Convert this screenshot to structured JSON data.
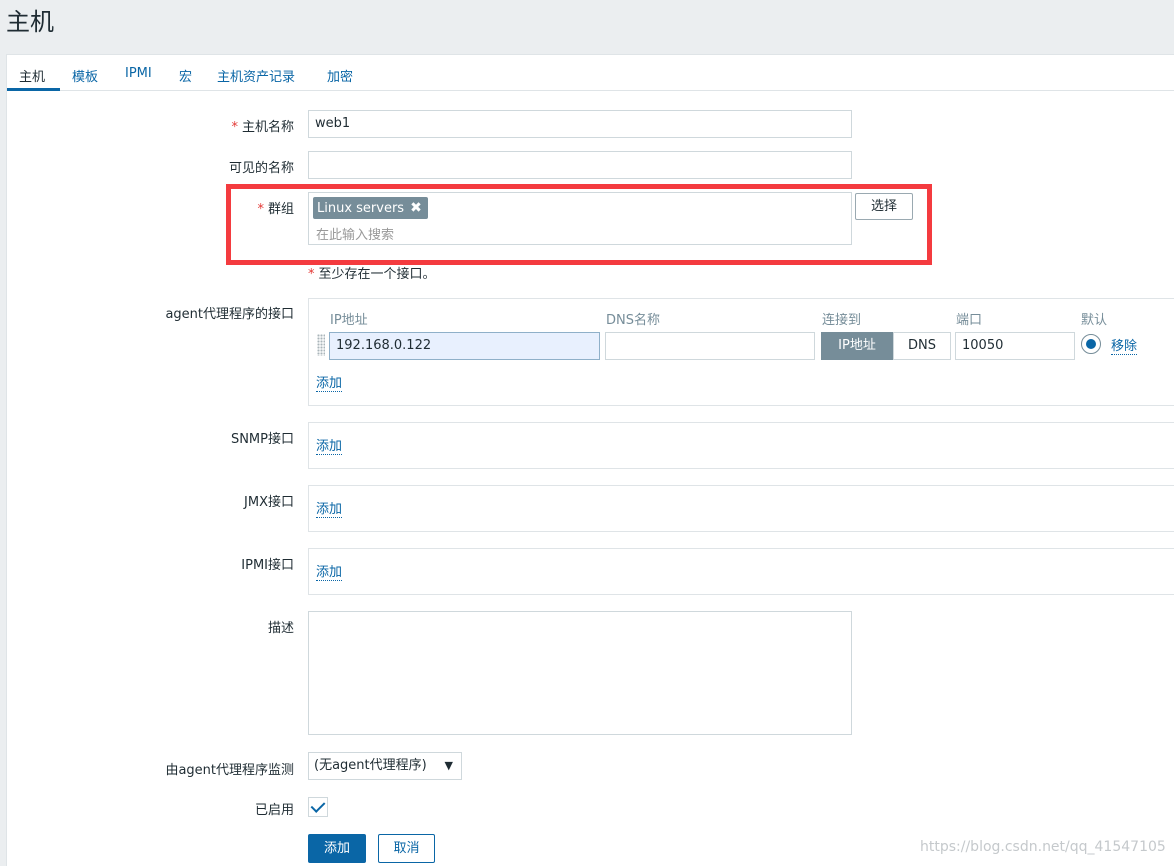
{
  "page": {
    "title": "主机"
  },
  "tabs": [
    "主机",
    "模板",
    "IPMI",
    "宏",
    "主机资产记录",
    "加密"
  ],
  "form": {
    "host_name": {
      "required_mark": "*",
      "label": "主机名称",
      "value": "web1"
    },
    "visible_name": {
      "label": "可见的名称",
      "value": ""
    },
    "groups": {
      "required_mark": "*",
      "label": "群组",
      "selected": [
        "Linux servers"
      ],
      "remove_glyph": "✖",
      "placeholder": "在此输入搜索",
      "select_button": "选择"
    },
    "interface_note": {
      "required_mark": "*",
      "text": "至少存在一个接口。"
    },
    "agent_interfaces": {
      "label": "agent代理程序的接口",
      "columns": {
        "ip": "IP地址",
        "dns": "DNS名称",
        "connect": "连接到",
        "port": "端口",
        "default": "默认"
      },
      "row": {
        "ip": "192.168.0.122",
        "dns": "",
        "connect_ip": "IP地址",
        "connect_dns": "DNS",
        "port": "10050",
        "remove": "移除"
      },
      "add": "添加"
    },
    "snmp_interfaces": {
      "label": "SNMP接口",
      "add": "添加"
    },
    "jmx_interfaces": {
      "label": "JMX接口",
      "add": "添加"
    },
    "ipmi_interfaces": {
      "label": "IPMI接口",
      "add": "添加"
    },
    "description": {
      "label": "描述",
      "value": ""
    },
    "monitored_by": {
      "label": "由agent代理程序监测",
      "value": "(无agent代理程序)",
      "caret": "▼"
    },
    "enabled": {
      "label": "已启用",
      "checked": true
    },
    "buttons": {
      "add": "添加",
      "cancel": "取消"
    }
  },
  "watermark": "https://blog.csdn.net/qq_41547105",
  "colors": {
    "accent": "#0a66a6",
    "required": "#e33734",
    "highlight": "#f43b3f",
    "tag": "#768d99"
  }
}
